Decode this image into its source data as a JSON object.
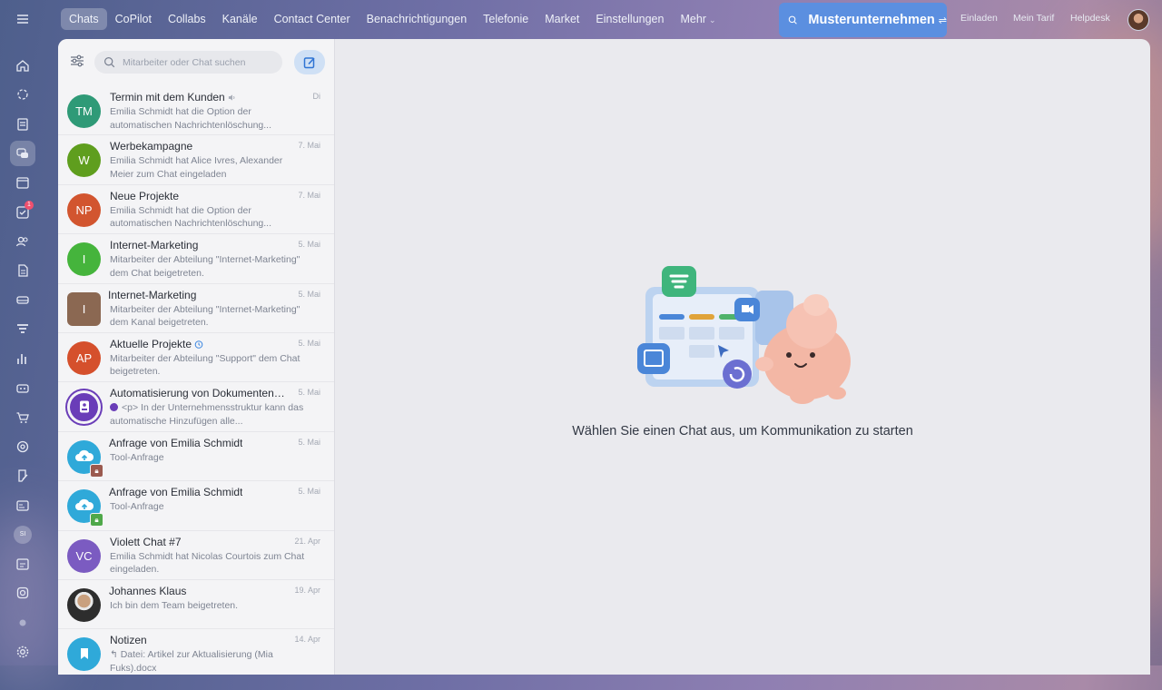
{
  "topnav": {
    "items": [
      {
        "label": "Chats",
        "active": true
      },
      {
        "label": "CoPilot"
      },
      {
        "label": "Collabs"
      },
      {
        "label": "Kanäle"
      },
      {
        "label": "Contact Center"
      },
      {
        "label": "Benachrichtigungen"
      },
      {
        "label": "Telefonie"
      },
      {
        "label": "Market"
      },
      {
        "label": "Einstellungen"
      },
      {
        "label": "Mehr"
      }
    ],
    "company": "Musterunternehmen",
    "links": {
      "invite": "Einladen",
      "plan": "Mein Tarif",
      "help": "Helpdesk"
    }
  },
  "rail": {
    "badge": "1",
    "avatar_initials": "SI",
    "icons": [
      "home-icon",
      "sparkle-icon",
      "feed-icon",
      "chat-icon",
      "calendar-icon",
      "tasks-icon",
      "contacts-icon",
      "document-icon",
      "inbox-icon",
      "funnel-icon",
      "chart-icon",
      "robot-icon",
      "cart-icon",
      "target-icon",
      "sign-icon",
      "card-icon",
      "avatar",
      "schedule-icon",
      "marketplace-icon",
      "dot",
      "settings-icon"
    ]
  },
  "sidebar": {
    "search_placeholder": "Mitarbeiter oder Chat suchen",
    "chats": [
      {
        "title": "Termin mit dem Kunden",
        "date": "Di",
        "text": "Emilia Schmidt hat die Option der automatischen Nachrichtenlöschung...",
        "initials": "TM",
        "color": "#2f9a77",
        "muted": true
      },
      {
        "title": "Werbekampagne",
        "date": "7. Mai",
        "text": "Emilia Schmidt hat Alice Ivres, Alexander Meier zum Chat eingeladen",
        "initials": "W",
        "color": "#5f9e1e"
      },
      {
        "title": "Neue Projekte",
        "date": "7. Mai",
        "text": "Emilia Schmidt hat die Option der automatischen Nachrichtenlöschung...",
        "initials": "NP",
        "color": "#d2552f"
      },
      {
        "title": "Internet-Marketing",
        "date": "5. Mai",
        "text": "Mitarbeiter der Abteilung \"Internet-Marketing\" dem Chat beigetreten.",
        "initials": "I",
        "color": "#45b43c"
      },
      {
        "title": "Internet-Marketing",
        "date": "5. Mai",
        "text": "Mitarbeiter der Abteilung \"Internet-Marketing\" dem Kanal beigetreten.",
        "initials": "I",
        "color": "#8b6852",
        "square": true
      },
      {
        "title": "Aktuelle Projekte",
        "date": "5. Mai",
        "text": "Mitarbeiter der Abteilung \"Support\" dem Chat beigetreten.",
        "initials": "AP",
        "color": "#d5502c",
        "timer": true
      },
      {
        "title": "Automatisierung von Dokumenten i...",
        "date": "5. Mai",
        "text": "<p> In der Unternehmensstruktur kann das automatische Hinzufügen alle...",
        "initials": "",
        "color": "#6a3db8",
        "doc": true
      },
      {
        "title": "Anfrage von Emilia Schmidt",
        "date": "5. Mai",
        "text": "Tool-Anfrage",
        "initials": "",
        "color": "#2fa9d9",
        "lock": "#9b5a4f"
      },
      {
        "title": "Anfrage von Emilia Schmidt",
        "date": "5. Mai",
        "text": "Tool-Anfrage",
        "initials": "",
        "color": "#2fa9d9",
        "lock": "#4fa84a"
      },
      {
        "title": "Violett Chat #7",
        "date": "21. Apr",
        "text": "Emilia Schmidt hat Nicolas Courtois zum Chat eingeladen.",
        "initials": "VC",
        "color": "#7b5bc1"
      },
      {
        "title": "Johannes Klaus",
        "date": "19. Apr",
        "text": "Ich bin dem Team beigetreten.",
        "initials": "",
        "color": "#3a3a3a",
        "photo": true
      },
      {
        "title": "Notizen",
        "date": "14. Apr",
        "text": "↰ Datei: Artikel zur Aktualisierung (Mia Fuks).docx",
        "initials": "",
        "color": "#2fa9d9",
        "bookmark": true
      }
    ]
  },
  "main": {
    "empty_text": "Wählen Sie einen Chat aus, um Kommunikation zu starten"
  }
}
